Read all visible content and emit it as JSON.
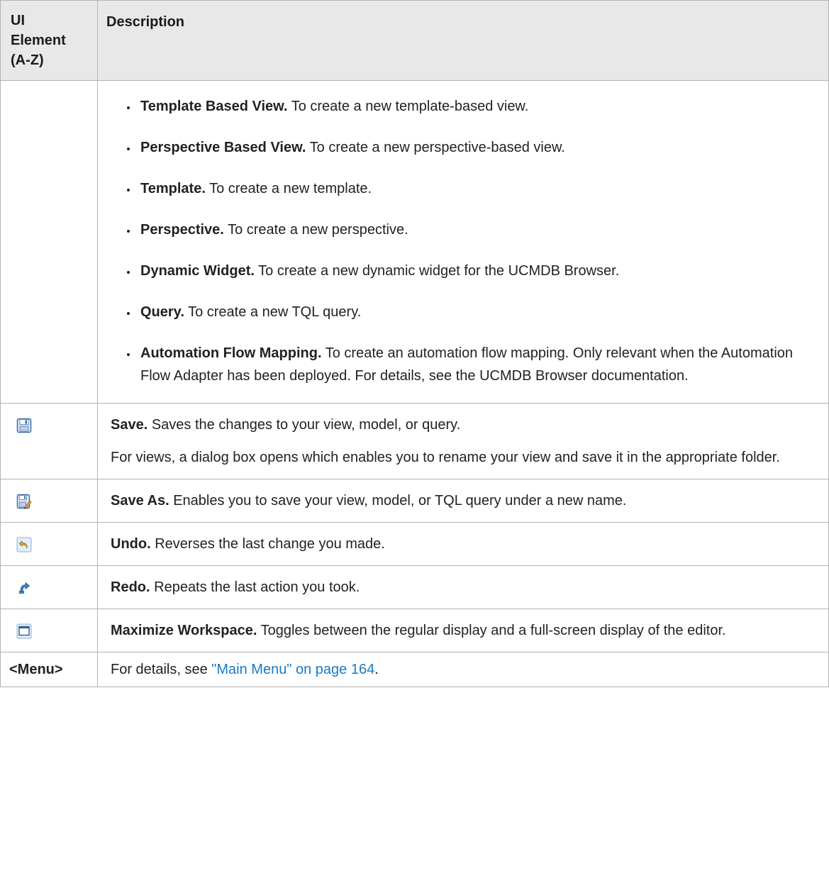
{
  "header": {
    "col1": "UI Element (A-Z)",
    "col1_lines": [
      "UI",
      "Element",
      "(A-Z)"
    ],
    "col2": "Description"
  },
  "new_items": [
    {
      "term": "Template Based View.",
      "desc": "To create a new template-based view."
    },
    {
      "term": "Perspective Based View.",
      "desc": "To create a new perspective-based view."
    },
    {
      "term": "Template.",
      "desc": "To create a new template."
    },
    {
      "term": "Perspective.",
      "desc": "To create a new perspective."
    },
    {
      "term": "Dynamic Widget.",
      "desc": "To create a new dynamic widget for the UCMDB Browser."
    },
    {
      "term": "Query.",
      "desc": "To create a new TQL query."
    },
    {
      "term": "Automation Flow Mapping.",
      "desc": "To create an automation flow mapping. Only relevant when the Automation Flow Adapter has been deployed. For details, see the UCMDB Browser documentation."
    }
  ],
  "rows": {
    "save": {
      "icon": "save-icon",
      "term": "Save.",
      "desc": "Saves the changes to your view, model, or query.",
      "extra": "For views, a dialog box opens which enables you to rename your view and save it in the appropriate folder."
    },
    "save_as": {
      "icon": "save-as-icon",
      "term": "Save As.",
      "desc": "Enables you to save your view, model, or TQL query under a new name."
    },
    "undo": {
      "icon": "undo-icon",
      "term": "Undo.",
      "desc": "Reverses the last change you made."
    },
    "redo": {
      "icon": "redo-icon",
      "term": "Redo.",
      "desc": "Repeats the last action you took."
    },
    "maximize": {
      "icon": "maximize-workspace-icon",
      "term": "Maximize Workspace.",
      "desc": "Toggles between the regular display and a full-screen display of the editor."
    },
    "menu": {
      "key": "<Menu>",
      "prefix": "For details, see ",
      "link": "\"Main Menu\" on page 164",
      "suffix": "."
    }
  },
  "colors": {
    "link": "#1a7ac3",
    "header_bg": "#e8e8e8",
    "border": "#b3b3b3"
  }
}
